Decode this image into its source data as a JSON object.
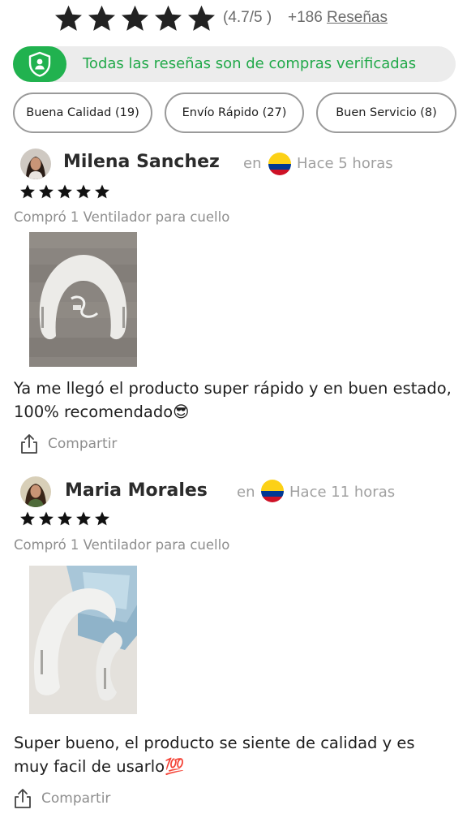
{
  "header": {
    "stars": 5,
    "score_text": "(4.7/5 )",
    "count_text": "+186",
    "reviews_link": "Reseñas",
    "star_color": "#222222"
  },
  "verified": {
    "text": "Todas las reseñas son de compras verificadas",
    "icon": "shield-user-icon",
    "accent": "#21b24f"
  },
  "filters": [
    {
      "label": "Buena Calidad (19)"
    },
    {
      "label": "Envío Rápido (27)"
    },
    {
      "label": "Buen Servicio (8)"
    }
  ],
  "reviews": [
    {
      "name": "Milena Sanchez",
      "en": "en",
      "flag": "colombia-flag",
      "time": "Hace 5 horas",
      "rating": 5,
      "purchase": "Compró 1 Ventilador para cuello",
      "text": "Ya me llegó el producto super rápido y en buen estado, 100% recomendado😎",
      "share": "Compartir"
    },
    {
      "name": "Maria Morales",
      "en": "en",
      "flag": "colombia-flag",
      "time": "Hace 11 horas",
      "rating": 5,
      "purchase": "Compró 1 Ventilador para cuello",
      "text": "Super bueno, el producto se siente de calidad y es muy facil de usarlo💯",
      "share": "Compartir"
    }
  ]
}
